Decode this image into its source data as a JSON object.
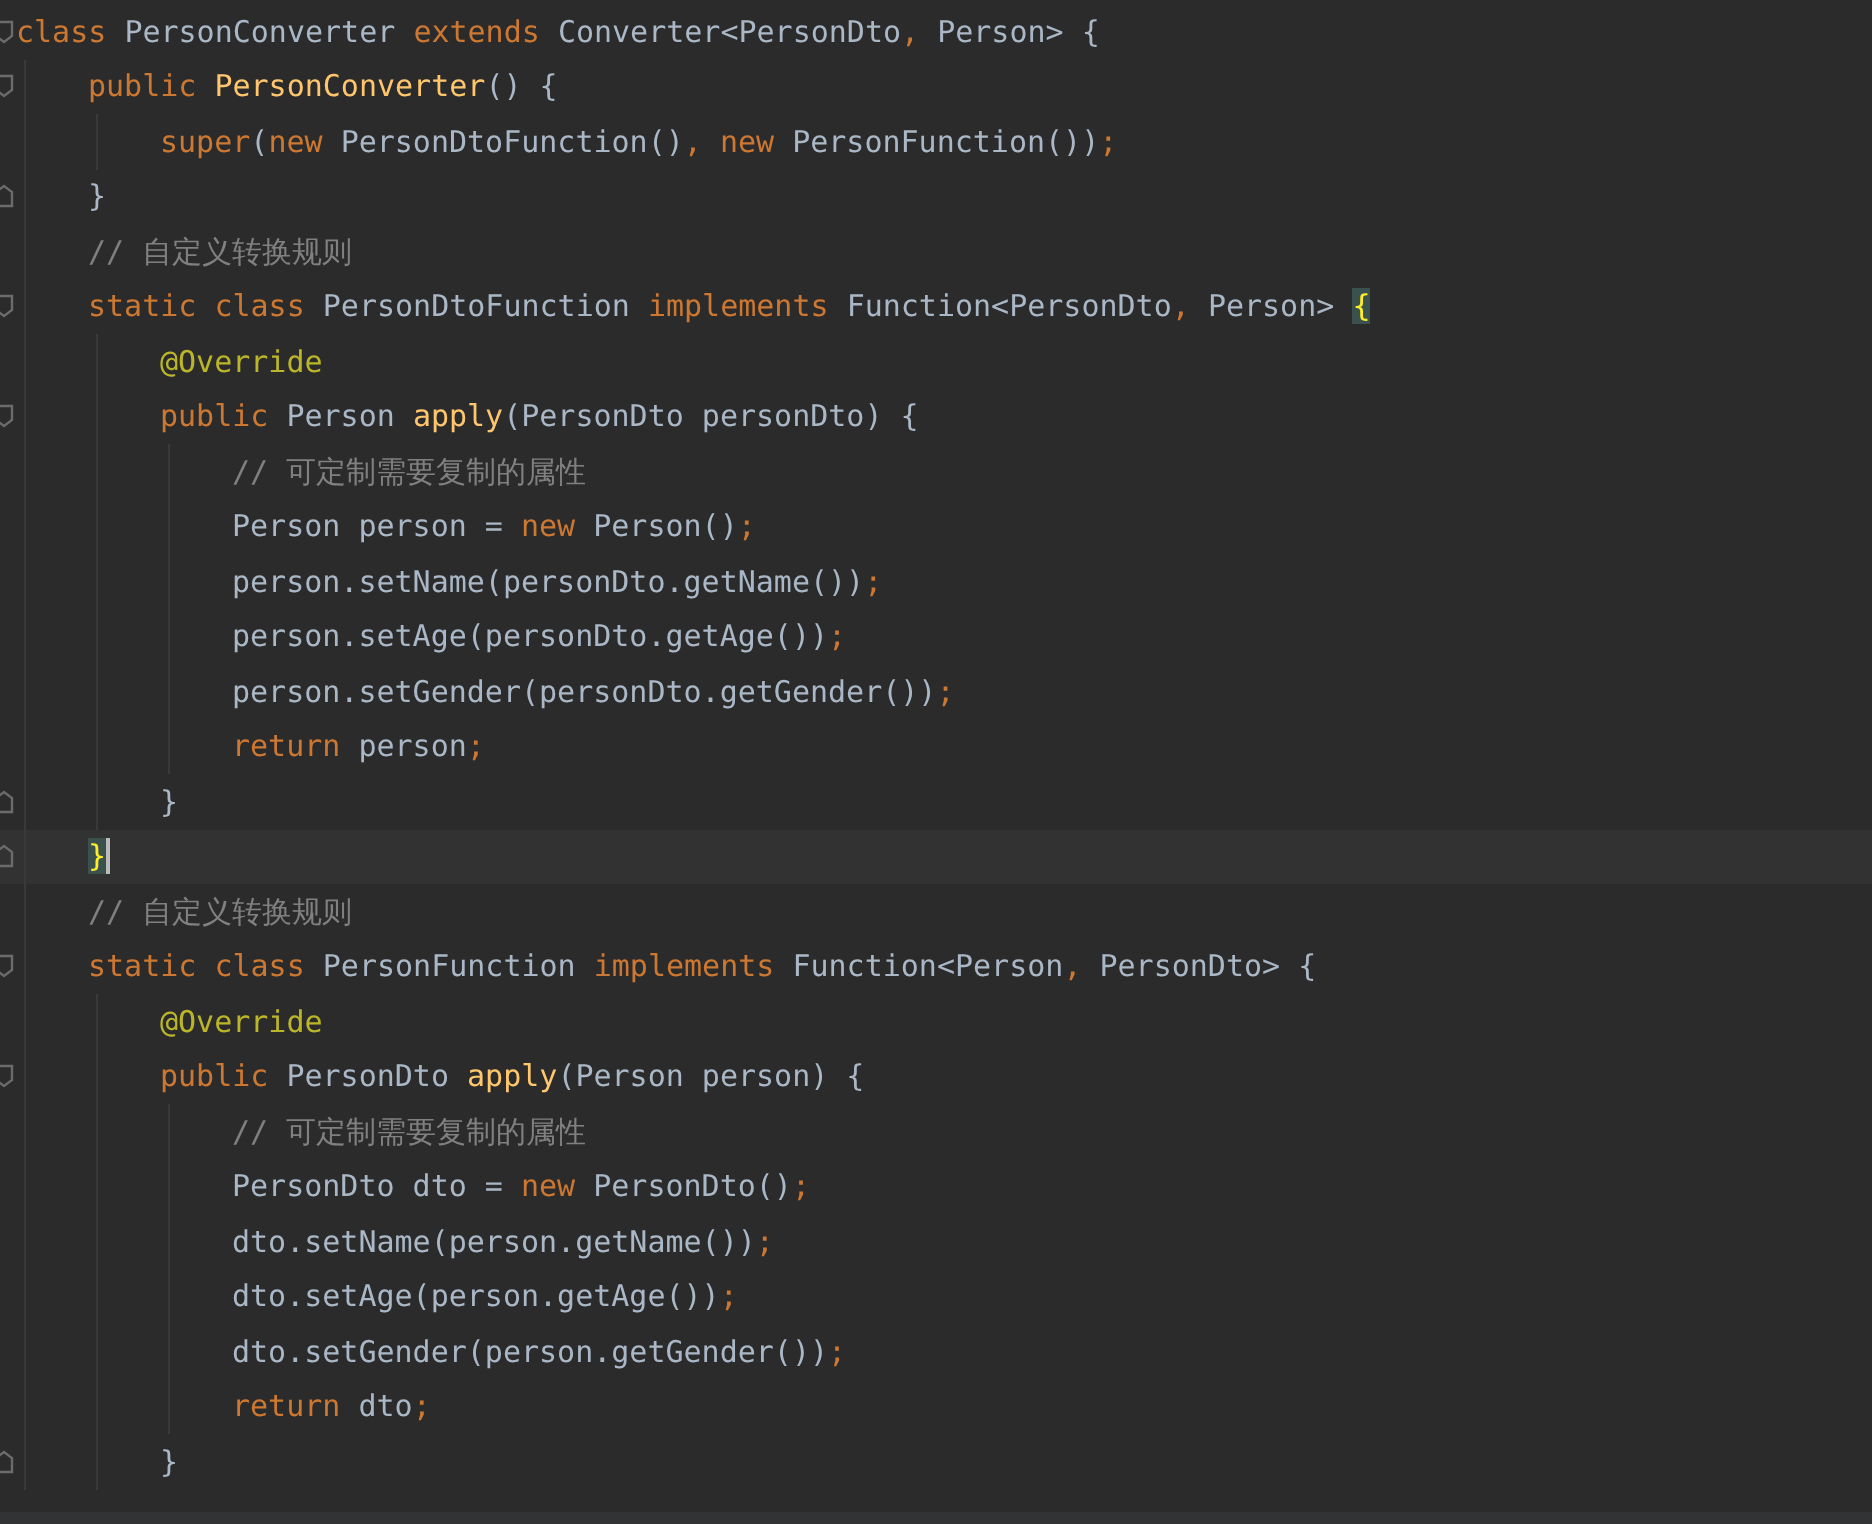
{
  "editor": {
    "lines": [
      {
        "kind": "block",
        "tokens": [
          {
            "kind": "keyword",
            "text": "class "
          },
          {
            "kind": "plain",
            "text": "PersonConverter "
          },
          {
            "kind": "keyword",
            "text": "extends "
          },
          {
            "kind": "plain",
            "text": "Converter<PersonDto"
          },
          {
            "kind": "keyword",
            "text": ", "
          },
          {
            "kind": "plain",
            "text": "Person> {"
          }
        ],
        "children": [
          {
            "kind": "block",
            "tokens": [
              {
                "kind": "keyword",
                "text": "public "
              },
              {
                "kind": "declaration",
                "text": "PersonConverter"
              },
              {
                "kind": "plain",
                "text": "() {"
              }
            ],
            "children": [
              {
                "kind": "statement",
                "tokens": [
                  {
                    "kind": "keyword",
                    "text": "super"
                  },
                  {
                    "kind": "plain",
                    "text": "("
                  },
                  {
                    "kind": "keyword",
                    "text": "new "
                  },
                  {
                    "kind": "plain",
                    "text": "PersonDtoFunction()"
                  },
                  {
                    "kind": "keyword",
                    "text": ", new "
                  },
                  {
                    "kind": "plain",
                    "text": "PersonFunction())"
                  },
                  {
                    "kind": "keyword",
                    "text": ";"
                  }
                ]
              }
            ]
          },
          {
            "kind": "closing",
            "tokens": [
              {
                "kind": "plain",
                "text": "}"
              }
            ]
          },
          {
            "kind": "statement",
            "tokens": [
              {
                "kind": "comment",
                "text": "// 自定义转换规则"
              }
            ]
          },
          {
            "kind": "block",
            "tokens": [
              {
                "kind": "keyword",
                "text": "static class "
              },
              {
                "kind": "plain",
                "text": "PersonDtoFunction "
              },
              {
                "kind": "keyword",
                "text": "implements "
              },
              {
                "kind": "plain",
                "text": "Function<PersonDto"
              },
              {
                "kind": "keyword",
                "text": ", "
              },
              {
                "kind": "plain",
                "text": "Person> "
              },
              {
                "kind": "brace",
                "text": "{",
                "matched": true
              }
            ],
            "children": [
              {
                "kind": "statement",
                "tokens": [
                  {
                    "kind": "annotation",
                    "text": "@Override"
                  }
                ]
              },
              {
                "kind": "block",
                "tokens": [
                  {
                    "kind": "keyword",
                    "text": "public "
                  },
                  {
                    "kind": "plain",
                    "text": "Person "
                  },
                  {
                    "kind": "declaration",
                    "text": "apply"
                  },
                  {
                    "kind": "plain",
                    "text": "(PersonDto personDto) {"
                  }
                ],
                "children": [
                  {
                    "kind": "statement",
                    "tokens": [
                      {
                        "kind": "comment",
                        "text": "// 可定制需要复制的属性"
                      }
                    ]
                  },
                  {
                    "kind": "statement",
                    "tokens": [
                      {
                        "kind": "plain",
                        "text": "Person person = "
                      },
                      {
                        "kind": "keyword",
                        "text": "new "
                      },
                      {
                        "kind": "plain",
                        "text": "Person()"
                      },
                      {
                        "kind": "keyword",
                        "text": ";"
                      }
                    ]
                  },
                  {
                    "kind": "statement",
                    "tokens": [
                      {
                        "kind": "plain",
                        "text": "person.setName(personDto.getName())"
                      },
                      {
                        "kind": "keyword",
                        "text": ";"
                      }
                    ]
                  },
                  {
                    "kind": "statement",
                    "tokens": [
                      {
                        "kind": "plain",
                        "text": "person.setAge(personDto.getAge())"
                      },
                      {
                        "kind": "keyword",
                        "text": ";"
                      }
                    ]
                  },
                  {
                    "kind": "statement",
                    "tokens": [
                      {
                        "kind": "plain",
                        "text": "person.setGender(personDto.getGender())"
                      },
                      {
                        "kind": "keyword",
                        "text": ";"
                      }
                    ]
                  },
                  {
                    "kind": "statement",
                    "tokens": [
                      {
                        "kind": "keyword",
                        "text": "return "
                      },
                      {
                        "kind": "plain",
                        "text": "person"
                      },
                      {
                        "kind": "keyword",
                        "text": ";"
                      }
                    ]
                  }
                ]
              },
              {
                "kind": "closing",
                "tokens": [
                  {
                    "kind": "plain",
                    "text": "}"
                  }
                ]
              }
            ]
          },
          {
            "kind": "closing",
            "tokens": [
              {
                "kind": "brace",
                "text": "}",
                "matched": true,
                "caret": true
              }
            ]
          },
          {
            "kind": "statement",
            "tokens": [
              {
                "kind": "comment",
                "text": "// 自定义转换规则"
              }
            ]
          },
          {
            "kind": "block",
            "tokens": [
              {
                "kind": "keyword",
                "text": "static class "
              },
              {
                "kind": "plain",
                "text": "PersonFunction "
              },
              {
                "kind": "keyword",
                "text": "implements "
              },
              {
                "kind": "plain",
                "text": "Function<Person"
              },
              {
                "kind": "keyword",
                "text": ", "
              },
              {
                "kind": "plain",
                "text": "PersonDto> {"
              }
            ],
            "children": [
              {
                "kind": "statement",
                "tokens": [
                  {
                    "kind": "annotation",
                    "text": "@Override"
                  }
                ]
              },
              {
                "kind": "block",
                "tokens": [
                  {
                    "kind": "keyword",
                    "text": "public "
                  },
                  {
                    "kind": "plain",
                    "text": "PersonDto "
                  },
                  {
                    "kind": "declaration",
                    "text": "apply"
                  },
                  {
                    "kind": "plain",
                    "text": "(Person person) {"
                  }
                ],
                "children": [
                  {
                    "kind": "statement",
                    "tokens": [
                      {
                        "kind": "comment",
                        "text": "// 可定制需要复制的属性"
                      }
                    ]
                  },
                  {
                    "kind": "statement",
                    "tokens": [
                      {
                        "kind": "plain",
                        "text": "PersonDto dto = "
                      },
                      {
                        "kind": "keyword",
                        "text": "new "
                      },
                      {
                        "kind": "plain",
                        "text": "PersonDto()"
                      },
                      {
                        "kind": "keyword",
                        "text": ";"
                      }
                    ]
                  },
                  {
                    "kind": "statement",
                    "tokens": [
                      {
                        "kind": "plain",
                        "text": "dto.setName(person.getName())"
                      },
                      {
                        "kind": "keyword",
                        "text": ";"
                      }
                    ]
                  },
                  {
                    "kind": "statement",
                    "tokens": [
                      {
                        "kind": "plain",
                        "text": "dto.setAge(person.getAge())"
                      },
                      {
                        "kind": "keyword",
                        "text": ";"
                      }
                    ]
                  },
                  {
                    "kind": "statement",
                    "tokens": [
                      {
                        "kind": "plain",
                        "text": "dto.setGender(person.getGender())"
                      },
                      {
                        "kind": "keyword",
                        "text": ";"
                      }
                    ]
                  },
                  {
                    "kind": "statement",
                    "tokens": [
                      {
                        "kind": "keyword",
                        "text": "return "
                      },
                      {
                        "kind": "plain",
                        "text": "dto"
                      },
                      {
                        "kind": "keyword",
                        "text": ";"
                      }
                    ]
                  }
                ]
              },
              {
                "kind": "closing",
                "tokens": [
                  {
                    "kind": "plain",
                    "text": "}"
                  }
                ]
              }
            ]
          }
        ]
      }
    ]
  }
}
